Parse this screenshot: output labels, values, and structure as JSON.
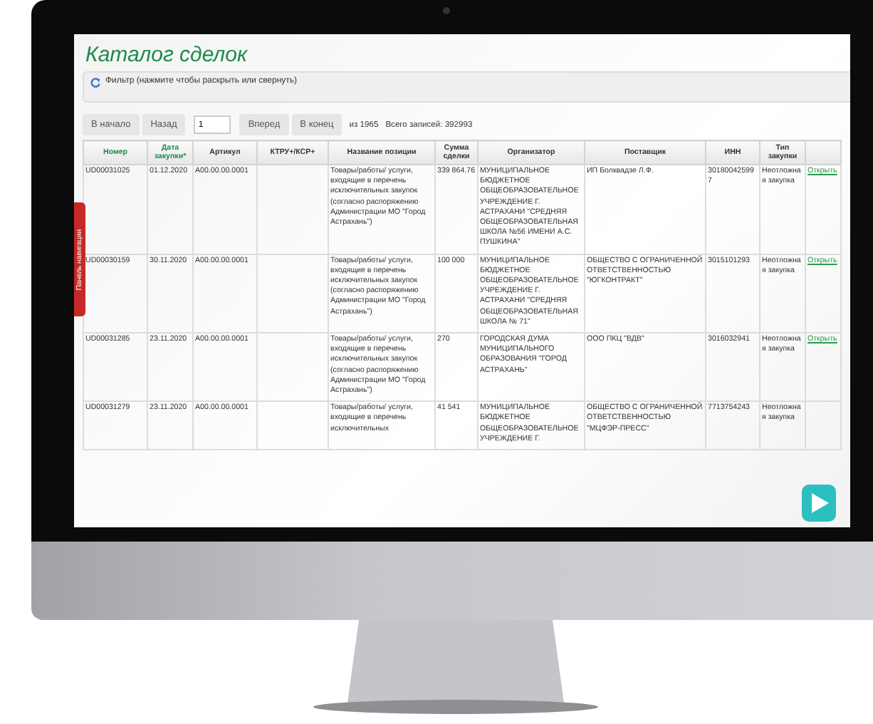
{
  "page": {
    "title": "Каталог сделок",
    "filter": "Фильтр (нажмите чтобы раскрыть или свернуть)",
    "side_tab": "Панель навигации"
  },
  "pager": {
    "first": "В начало",
    "prev": "Назад",
    "page": "1",
    "next": "Вперед",
    "last": "В конец",
    "of": "из 1965",
    "total": "Всего записей: 392993"
  },
  "table": {
    "columns": [
      {
        "label": "Номер",
        "sortable": true
      },
      {
        "label": "Дата закупки*",
        "sortable": true
      },
      {
        "label": "Артикул",
        "sortable": false
      },
      {
        "label": "КТРУ+/КСР+",
        "sortable": false
      },
      {
        "label": "Название позиции",
        "sortable": false
      },
      {
        "label": "Сумма сделки",
        "sortable": false
      },
      {
        "label": "Организатор",
        "sortable": false
      },
      {
        "label": "Поставщик",
        "sortable": false
      },
      {
        "label": "ИНН",
        "sortable": false
      },
      {
        "label": "Тип закупки",
        "sortable": false
      }
    ],
    "rows": [
      {
        "cells": [
          "UD00031025",
          "01.12.2020",
          "A00.00.00.0001",
          "",
          "Товары/работы/ услуги, входящие в перечень исключительных закупок (согласно распоряжению Администрации МО \"Город Астрахань\")",
          "339 864.76",
          "МУНИЦИПАЛЬНОЕ БЮДЖЕТНОЕ ОБЩЕОБРАЗОВАТЕЛЬНОЕ УЧРЕЖДЕНИЕ Г. АСТРАХАНИ \"СРЕДНЯЯ ОБЩЕОБРАЗОВАТЕЛЬНАЯ ШКОЛА №56 ИМЕНИ А.С. ПУШКИНА\"",
          "ИП Болквадзе Л.Ф.",
          "301800425997",
          "Неотложная закупка"
        ],
        "link": "Открыть"
      },
      {
        "cells": [
          "UD00030159",
          "30.11.2020",
          "A00.00.00.0001",
          "",
          "Товары/работы/ услуги, входящие в перечень исключительных закупок (согласно распоряжению Администрации МО \"Город Астрахань\")",
          "100 000",
          "МУНИЦИПАЛЬНОЕ БЮДЖЕТНОЕ ОБЩЕОБРАЗОВАТЕЛЬНОЕ УЧРЕЖДЕНИЕ Г. АСТРАХАНИ \"СРЕДНЯЯ ОБЩЕОБРАЗОВАТЕЛЬНАЯ ШКОЛА № 71\"",
          "ОБЩЕСТВО С ОГРАНИЧЕННОЙ ОТВЕТСТВЕННОСТЬЮ \"ЮГКОНТРАКТ\"",
          "3015101293",
          "Неотложная закупка"
        ],
        "link": "Открыть"
      },
      {
        "cells": [
          "UD00031285",
          "23.11.2020",
          "A00.00.00.0001",
          "",
          "Товары/работы/ услуги, входящие в перечень исключительных закупок (согласно распоряжению Администрации МО \"Город Астрахань\")",
          "270",
          "ГОРОДСКАЯ ДУМА МУНИЦИПАЛЬНОГО ОБРАЗОВАНИЯ \"ГОРОД АСТРАХАНЬ\"",
          "ООО ПКЦ \"ВДВ\"",
          "3016032941",
          "Неотложная закупка"
        ],
        "link": "Открыть"
      },
      {
        "cells": [
          "UD00031279",
          "23.11.2020",
          "A00.00.00.0001",
          "",
          "Товары/работы/ услуги, входящие в перечень исключительных",
          "41 541",
          "МУНИЦИПАЛЬНОЕ БЮДЖЕТНОЕ ОБЩЕОБРАЗОВАТЕЛЬНОЕ УЧРЕЖДЕНИЕ Г.",
          "ОБЩЕСТВО С ОГРАНИЧЕННОЙ ОТВЕТСТВЕННОСТЬЮ \"МЦФЭР-ПРЕСС\"",
          "7713754243",
          "Неотложная закупка"
        ]
      }
    ]
  }
}
